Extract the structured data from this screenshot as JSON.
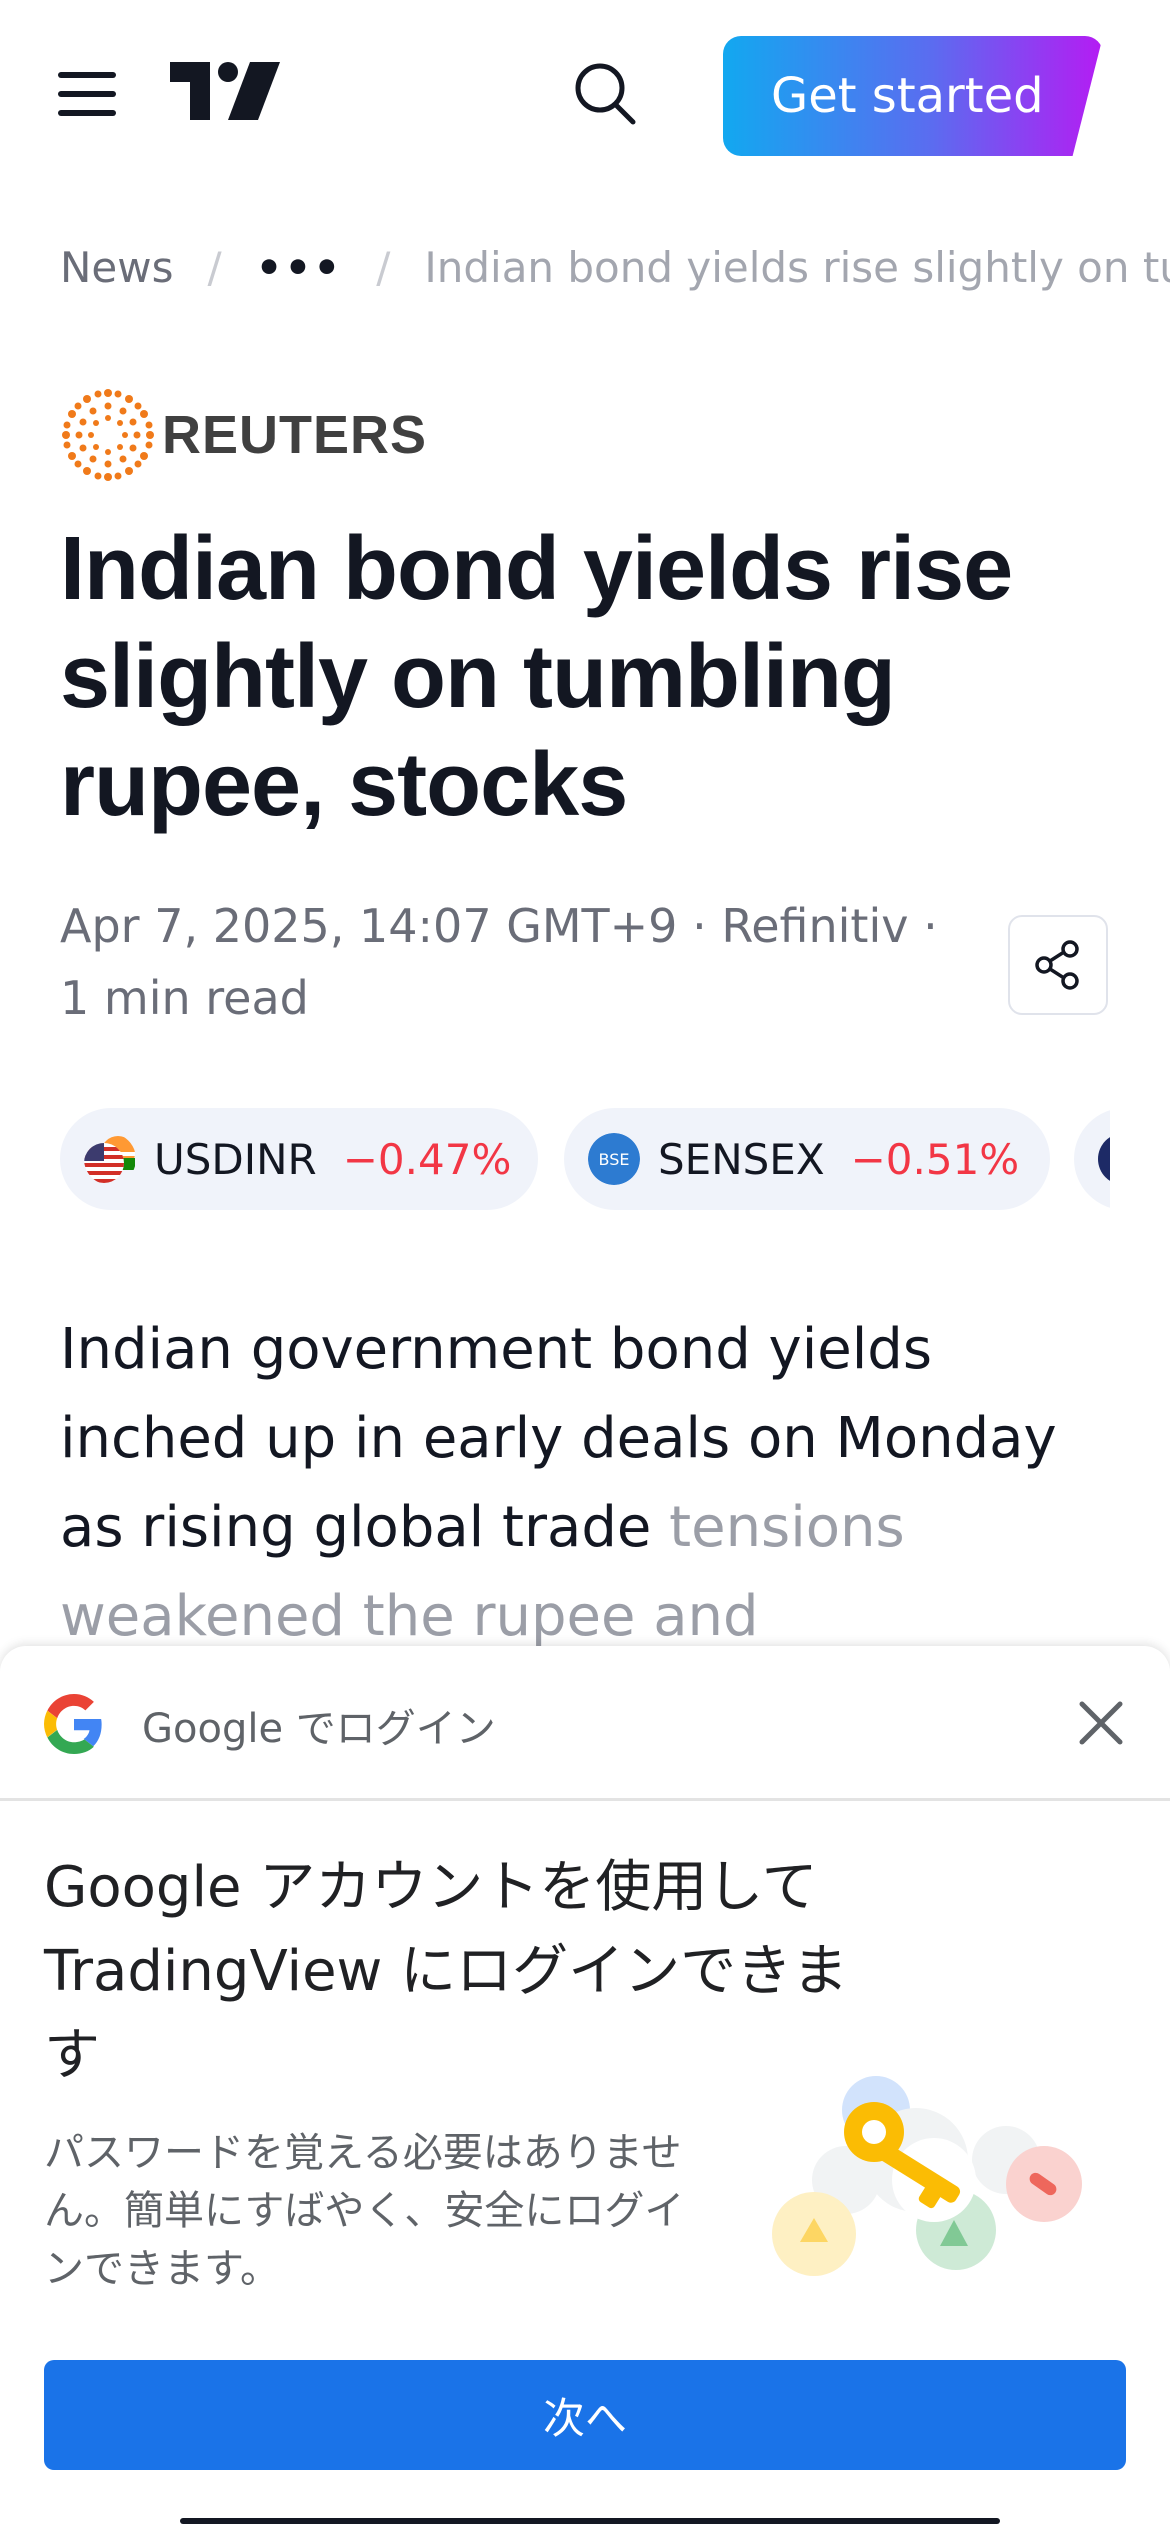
{
  "header": {
    "cta_label": "Get started",
    "menu_icon": "hamburger-menu-icon",
    "logo_icon": "tradingview-logo-icon",
    "search_icon": "search-icon"
  },
  "breadcrumb": {
    "items": [
      "News",
      "•••",
      "Indian bond yields rise slightly on tu"
    ]
  },
  "article": {
    "source": "REUTERS",
    "title": "Indian bond yields rise slightly on tumbling rupee, stocks",
    "meta": "Apr 7, 2025, 14:07 GMT+9 · Refinitiv · 1 min read",
    "share_icon": "share-icon",
    "body_visible": "Indian government bond yields inched up in early deals on Monday as rising global trade",
    "body_faded": "tensions weakened the rupee and"
  },
  "tickers": [
    {
      "symbol": "USDINR",
      "change": "−0.47%",
      "icon": "us-india-flag-icon"
    },
    {
      "symbol": "SENSEX",
      "change": "−0.51%",
      "icon": "bse-icon"
    }
  ],
  "colors": {
    "negative": "#f23645",
    "cta_start": "#12a8f0",
    "cta_end": "#b51cf3",
    "google_blue": "#1a73e8"
  },
  "google_sheet": {
    "header_title": "Google でログイン",
    "title": "Google アカウントを使用して TradingView にログインできます",
    "description": "パスワードを覚える必要はありません。簡単にすばやく、安全にログインできます。",
    "button_label": "次へ",
    "close_icon": "close-icon",
    "logo_icon": "google-g-icon"
  }
}
